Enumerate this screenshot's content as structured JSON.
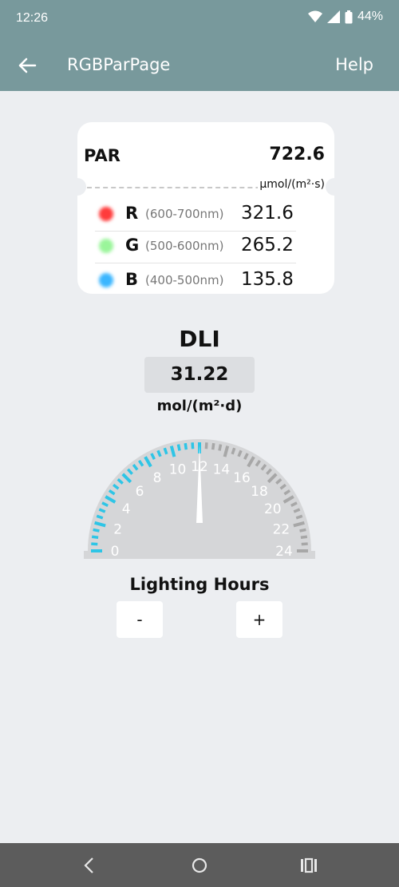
{
  "status_bar": {
    "time": "12:26",
    "battery": "44%",
    "icons": [
      "wifi-icon",
      "signal-icon",
      "battery-icon"
    ]
  },
  "app_bar": {
    "title": "RGBParPage",
    "help": "Help",
    "back_icon": "arrow-left-icon"
  },
  "par_card": {
    "label": "PAR",
    "value": "722.6",
    "unit": "μmol/(m²·s)",
    "rows": [
      {
        "letter": "R",
        "range": "(600-700nm)",
        "value": "321.6",
        "color": "#ff3b3b"
      },
      {
        "letter": "G",
        "range": "(500-600nm)",
        "value": "265.2",
        "color": "#9af59a"
      },
      {
        "letter": "B",
        "range": "(400-500nm)",
        "value": "135.8",
        "color": "#3bb6ff"
      }
    ]
  },
  "dli": {
    "title": "DLI",
    "value": "31.22",
    "unit": "mol/(m²·d)"
  },
  "gauge": {
    "min": 0,
    "max": 24,
    "current": 12,
    "labels": [
      "0",
      "2",
      "4",
      "6",
      "8",
      "10",
      "12",
      "14",
      "16",
      "18",
      "20",
      "22",
      "24"
    ],
    "active_color": "#2ec5e6",
    "inactive_color": "#a7a7a7",
    "face_color": "#d5d6d8"
  },
  "lighting": {
    "label": "Lighting Hours",
    "minus": "-",
    "plus": "+"
  },
  "nav_bar": {
    "icons": [
      "back-icon",
      "home-icon",
      "recents-icon"
    ]
  }
}
